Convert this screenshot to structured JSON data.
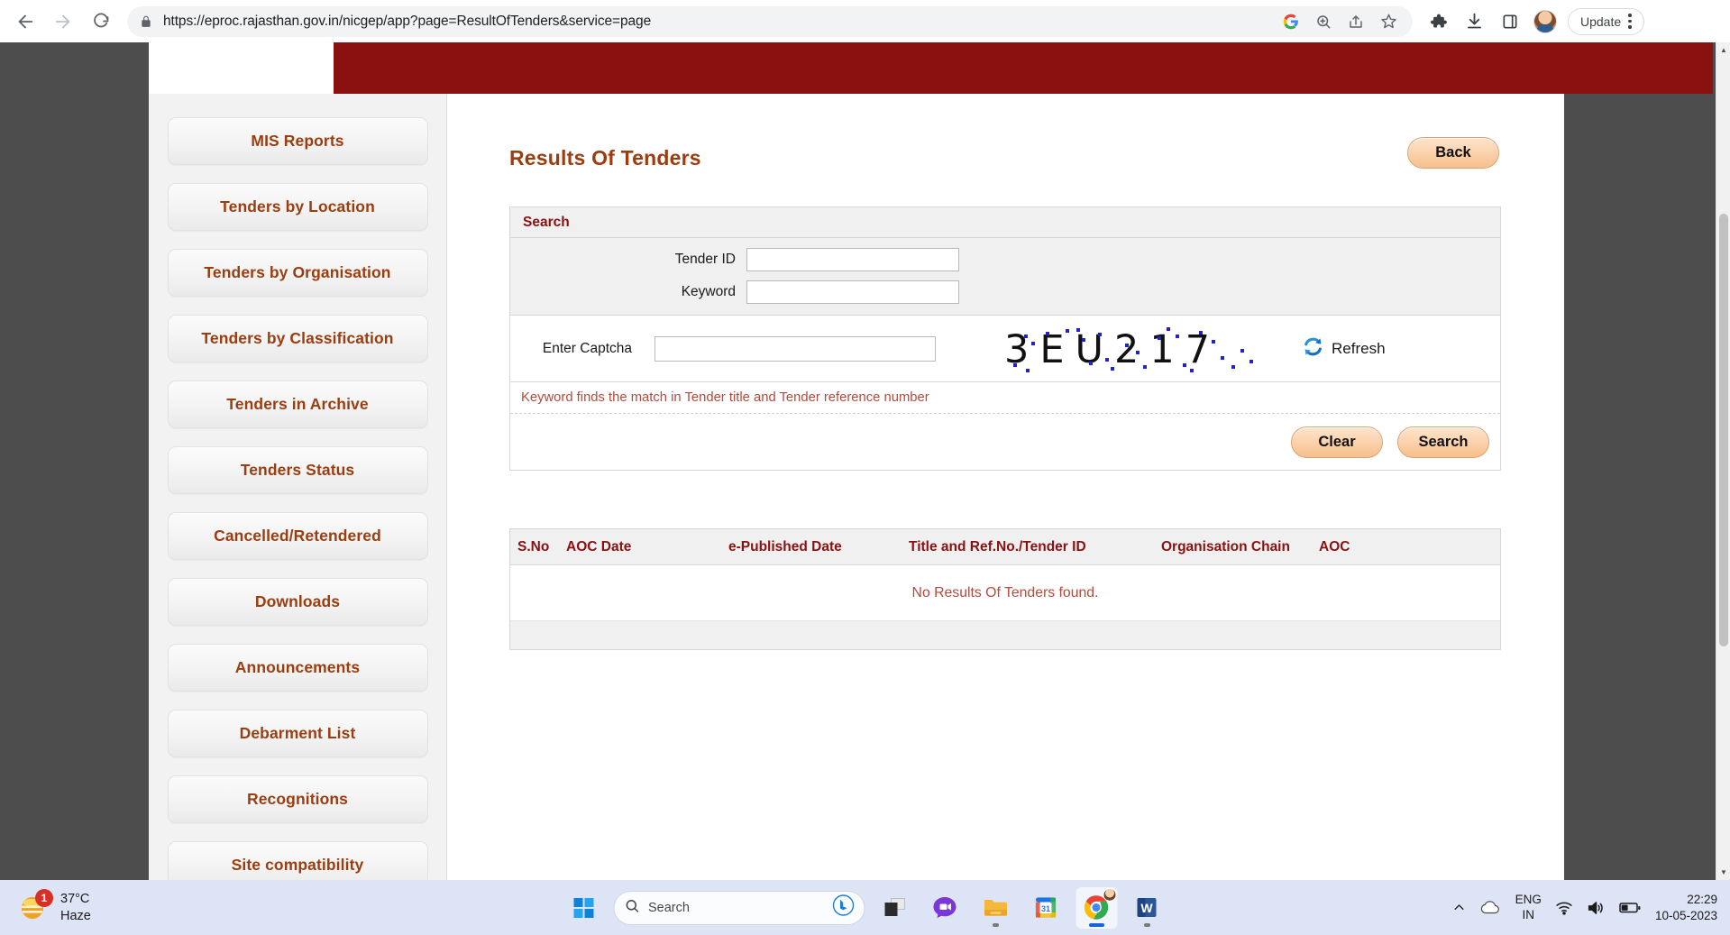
{
  "browser": {
    "url": "https://eproc.rajasthan.gov.in/nicgep/app?page=ResultOfTenders&service=page",
    "update_label": "Update",
    "icons": {
      "back": "back-arrow-icon",
      "forward": "forward-arrow-icon",
      "reload": "reload-icon",
      "lock": "lock-icon",
      "google": "google-g-icon",
      "zoom": "zoom-search-icon",
      "share": "share-icon",
      "bookmark": "star-icon",
      "extensions": "puzzle-piece-icon",
      "downloads": "download-icon",
      "sidepanel": "side-panel-icon",
      "profile": "avatar-icon",
      "menu": "kebab-menu-icon"
    }
  },
  "sidebar": {
    "items": [
      {
        "label": "MIS Reports"
      },
      {
        "label": "Tenders by Location"
      },
      {
        "label": "Tenders by Organisation"
      },
      {
        "label": "Tenders by Classification"
      },
      {
        "label": "Tenders in Archive"
      },
      {
        "label": "Tenders Status"
      },
      {
        "label": "Cancelled/Retendered"
      },
      {
        "label": "Downloads"
      },
      {
        "label": "Announcements"
      },
      {
        "label": "Debarment List"
      },
      {
        "label": "Recognitions"
      },
      {
        "label": "Site compatibility"
      }
    ]
  },
  "main": {
    "title": "Results Of Tenders",
    "back_label": "Back",
    "search": {
      "panel_title": "Search",
      "tender_id_label": "Tender ID",
      "tender_id_value": "",
      "tender_id_placeholder": "",
      "keyword_label": "Keyword",
      "keyword_value": "",
      "keyword_placeholder": "",
      "captcha_label": "Enter Captcha",
      "captcha_value": "",
      "captcha_placeholder": "",
      "captcha_text": "3EU217",
      "refresh_label": "Refresh",
      "refresh_icon": "refresh-circular-arrows-icon",
      "hint": "Keyword finds the match in Tender title and Tender reference number",
      "clear_label": "Clear",
      "search_label": "Search"
    },
    "results": {
      "columns": [
        "S.No",
        "AOC Date",
        "e-Published Date",
        "Title and Ref.No./Tender ID",
        "Organisation Chain",
        "AOC"
      ],
      "empty_message": "No Results Of Tenders found.",
      "rows": []
    }
  },
  "taskbar": {
    "weather_temp": "37°C",
    "weather_cond": "Haze",
    "weather_badge": "1",
    "search_placeholder": "Search",
    "icons": [
      {
        "name": "start-windows-icon"
      },
      {
        "name": "task-view-icon"
      },
      {
        "name": "teams-chat-icon"
      },
      {
        "name": "file-explorer-icon"
      },
      {
        "name": "google-calendar-icon"
      },
      {
        "name": "google-chrome-icon"
      },
      {
        "name": "microsoft-word-icon"
      }
    ],
    "tray": {
      "chevron": "chevron-up-icon",
      "cloud": "onedrive-cloud-icon",
      "lang_line1": "ENG",
      "lang_line2": "IN",
      "wifi": "wifi-icon",
      "volume": "speaker-icon",
      "battery": "battery-icon",
      "time": "22:29",
      "date": "10-05-2023"
    }
  },
  "colors": {
    "banner": "#8b1111",
    "accent_heading": "#9c3d10",
    "link_red": "#b44a3c",
    "button_peach": "#fbd3ad",
    "desktop_gray": "#4d4d4d"
  }
}
